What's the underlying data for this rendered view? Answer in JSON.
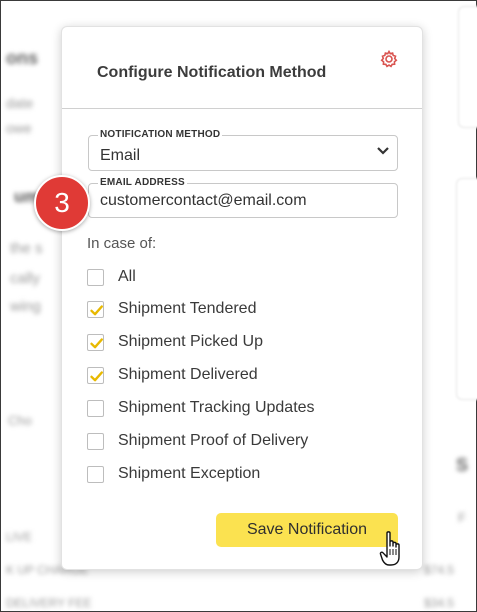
{
  "popup": {
    "title": "Configure Notification Method",
    "notification_method": {
      "label": "NOTIFICATION METHOD",
      "value": "Email"
    },
    "email_address": {
      "label": "EMAIL ADDRESS",
      "value": "customercontact@email.com"
    },
    "in_case_label": "In case of:",
    "options": [
      {
        "label": "All",
        "checked": false
      },
      {
        "label": "Shipment Tendered",
        "checked": true
      },
      {
        "label": "Shipment Picked Up",
        "checked": true
      },
      {
        "label": "Shipment Delivered",
        "checked": true
      },
      {
        "label": "Shipment Tracking Updates",
        "checked": false
      },
      {
        "label": "Shipment Proof of Delivery",
        "checked": false
      },
      {
        "label": "Shipment Exception",
        "checked": false
      }
    ],
    "save_label": "Save Notification"
  },
  "step_badge": "3",
  "colors": {
    "accent": "#fbe250",
    "badge": "#e03a36",
    "gear": "#d9534f",
    "check": "#e8b900"
  }
}
